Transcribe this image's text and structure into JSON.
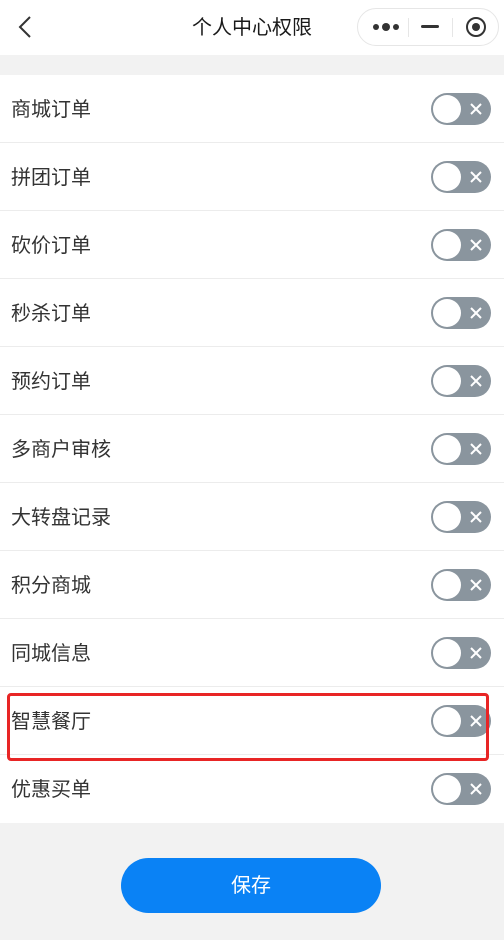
{
  "header": {
    "title": "个人中心权限",
    "back_icon": "chevron-left-icon",
    "capsule_icons": [
      "more-dots-icon",
      "minimize-icon",
      "close-target-icon"
    ]
  },
  "permissions": [
    {
      "label": "商城订单",
      "enabled": false
    },
    {
      "label": "拼团订单",
      "enabled": false
    },
    {
      "label": "砍价订单",
      "enabled": false
    },
    {
      "label": "秒杀订单",
      "enabled": false
    },
    {
      "label": "预约订单",
      "enabled": false
    },
    {
      "label": "多商户审核",
      "enabled": false
    },
    {
      "label": "大转盘记录",
      "enabled": false
    },
    {
      "label": "积分商城",
      "enabled": false
    },
    {
      "label": "同城信息",
      "enabled": false
    },
    {
      "label": "智慧餐厅",
      "enabled": false,
      "highlighted": true
    },
    {
      "label": "优惠买单",
      "enabled": false
    }
  ],
  "save_button": {
    "label": "保存"
  },
  "colors": {
    "switch_off": "#8a959e",
    "primary": "#0a82f5",
    "highlight": "#e82525"
  }
}
